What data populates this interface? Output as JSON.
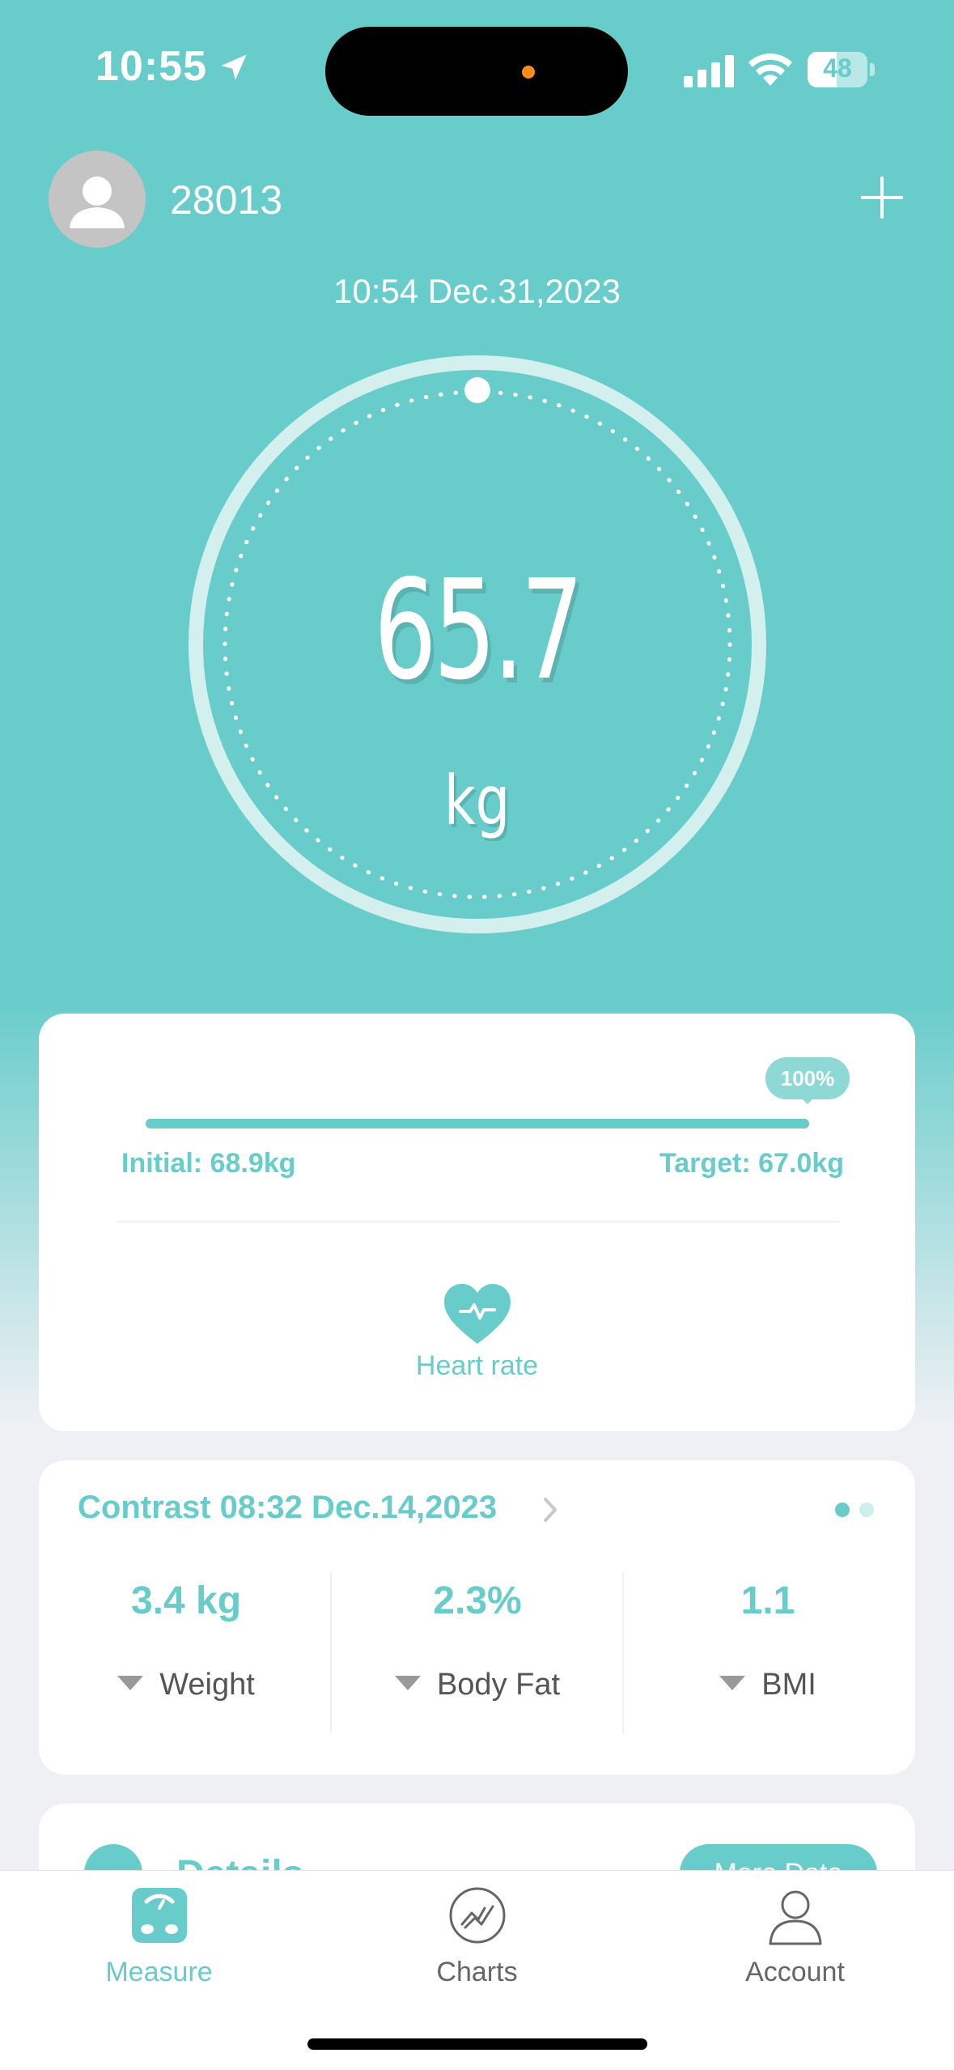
{
  "status_bar": {
    "time": "10:55",
    "battery": "48",
    "battery_level": 0.48
  },
  "header": {
    "username": "28013",
    "measurement_datetime": "10:54 Dec.31,2023"
  },
  "measurement": {
    "weight": "65.7",
    "unit": "kg"
  },
  "goal": {
    "progress_label": "100%",
    "progress": 1.0,
    "initial": "Initial: 68.9kg",
    "target": "Target: 67.0kg",
    "heart_rate_label": "Heart rate"
  },
  "contrast": {
    "title": "Contrast 08:32 Dec.14,2023",
    "items": [
      {
        "value": "3.4 kg",
        "label": "Weight"
      },
      {
        "value": "2.3%",
        "label": "Body Fat"
      },
      {
        "value": "1.1",
        "label": "BMI"
      }
    ]
  },
  "details": {
    "title": "Details",
    "more_button": "More Data"
  },
  "tabs": [
    {
      "label": "Measure",
      "icon": "scale-icon"
    },
    {
      "label": "Charts",
      "icon": "chart-icon"
    },
    {
      "label": "Account",
      "icon": "person-icon"
    }
  ],
  "colors": {
    "accent": "#67ccca",
    "background": "#eef0f4"
  }
}
